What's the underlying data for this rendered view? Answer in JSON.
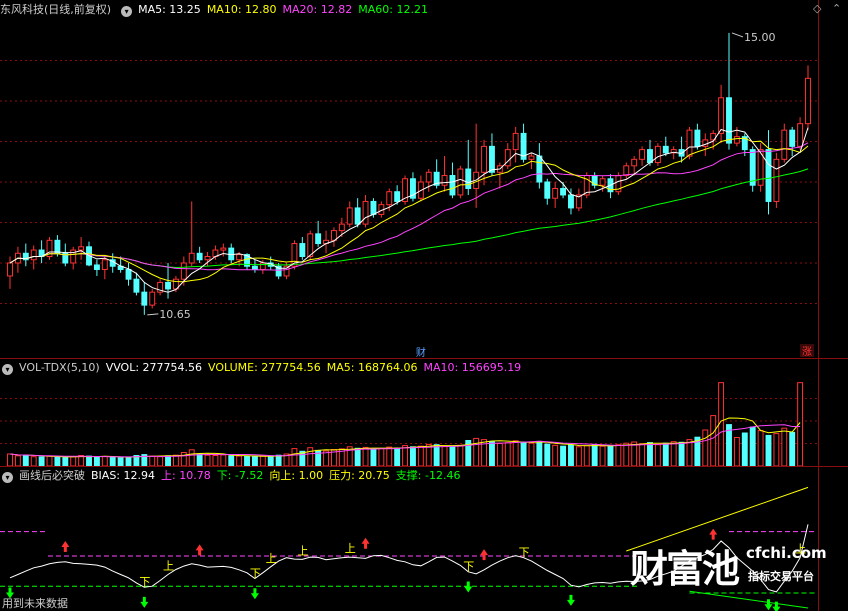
{
  "header1": {
    "title": "东风科技(日线,前复权)",
    "items": [
      {
        "text": "MA5: 13.25",
        "color": "#ffffff"
      },
      {
        "text": "MA10: 12.80",
        "color": "#ffff00"
      },
      {
        "text": "MA20: 12.82",
        "color": "#ff44ff"
      },
      {
        "text": "MA60: 12.21",
        "color": "#00ff00"
      }
    ]
  },
  "header2": {
    "title": "VOL-TDX(5,10)",
    "items": [
      {
        "text": "VVOL: 277754.56",
        "color": "#ffffff"
      },
      {
        "text": "VOLUME: 277754.56",
        "color": "#ffff00"
      },
      {
        "text": "MA5: 168764.06",
        "color": "#ffff00"
      },
      {
        "text": "MA10: 156695.19",
        "color": "#ff44ff"
      }
    ]
  },
  "header3": {
    "title": "画线后必突破",
    "items": [
      {
        "text": "BIAS: 12.94",
        "color": "#ffffff"
      },
      {
        "text": "上: 10.78",
        "color": "#ff44ff"
      },
      {
        "text": "下: -7.52",
        "color": "#00ff00"
      },
      {
        "text": "向上: 1.00",
        "color": "#ffff00"
      },
      {
        "text": "压力: 20.75",
        "color": "#ffff00"
      },
      {
        "text": "支撑: -12.46",
        "color": "#00ff00"
      }
    ]
  },
  "footer": "用到未来数据",
  "watermark": {
    "main": "财富池",
    "site": "cfchi.com",
    "sub": "指标交易平台"
  },
  "colors": {
    "up": "#ff3232",
    "down": "#54ffff",
    "ma5": "#ffffff",
    "ma10": "#ffff00",
    "ma20": "#ff44ff",
    "ma60": "#00ff00",
    "grid": "#8a0d0d"
  },
  "chart_data": [
    {
      "type": "candlestick",
      "ylim": [
        10.2,
        15.2
      ],
      "grid": true,
      "annotations": [
        {
          "label": "15.00",
          "at": "high"
        },
        {
          "label": "10.65",
          "at": "low"
        }
      ],
      "markers": [
        {
          "label": "财",
          "color": "#5aa0ff"
        },
        {
          "label": "涨",
          "color": "#ff3232"
        }
      ],
      "ohlc": [
        [
          11.25,
          11.55,
          11.05,
          11.45
        ],
        [
          11.45,
          11.7,
          11.3,
          11.6
        ],
        [
          11.6,
          11.75,
          11.4,
          11.5
        ],
        [
          11.5,
          11.72,
          11.35,
          11.65
        ],
        [
          11.65,
          11.8,
          11.45,
          11.55
        ],
        [
          11.55,
          11.85,
          11.5,
          11.8
        ],
        [
          11.8,
          11.88,
          11.55,
          11.6
        ],
        [
          11.6,
          11.75,
          11.4,
          11.45
        ],
        [
          11.45,
          11.7,
          11.35,
          11.65
        ],
        [
          11.65,
          11.85,
          11.5,
          11.7
        ],
        [
          11.7,
          11.78,
          11.4,
          11.42
        ],
        [
          11.42,
          11.5,
          11.25,
          11.35
        ],
        [
          11.35,
          11.55,
          11.2,
          11.5
        ],
        [
          11.5,
          11.6,
          11.3,
          11.4
        ],
        [
          11.4,
          11.55,
          11.3,
          11.35
        ],
        [
          11.35,
          11.45,
          11.1,
          11.2
        ],
        [
          11.2,
          11.3,
          10.95,
          11.0
        ],
        [
          11.0,
          11.15,
          10.65,
          10.8
        ],
        [
          10.8,
          11.05,
          10.75,
          11.0
        ],
        [
          11.0,
          11.2,
          10.95,
          11.15
        ],
        [
          11.15,
          11.45,
          10.9,
          11.05
        ],
        [
          11.05,
          11.25,
          11.0,
          11.2
        ],
        [
          11.2,
          11.55,
          11.1,
          11.45
        ],
        [
          11.45,
          12.4,
          11.4,
          11.6
        ],
        [
          11.6,
          11.7,
          11.45,
          11.5
        ],
        [
          11.5,
          11.62,
          11.4,
          11.55
        ],
        [
          11.55,
          11.72,
          11.5,
          11.65
        ],
        [
          11.65,
          11.75,
          11.55,
          11.68
        ],
        [
          11.68,
          11.75,
          11.45,
          11.5
        ],
        [
          11.5,
          11.62,
          11.4,
          11.58
        ],
        [
          11.58,
          11.6,
          11.35,
          11.4
        ],
        [
          11.4,
          11.5,
          11.3,
          11.35
        ],
        [
          11.35,
          11.5,
          11.28,
          11.45
        ],
        [
          11.45,
          11.55,
          11.35,
          11.4
        ],
        [
          11.4,
          11.45,
          11.2,
          11.25
        ],
        [
          11.25,
          11.45,
          11.2,
          11.4
        ],
        [
          11.4,
          11.8,
          11.35,
          11.75
        ],
        [
          11.75,
          11.85,
          11.5,
          11.55
        ],
        [
          11.55,
          11.95,
          11.5,
          11.9
        ],
        [
          11.9,
          12.1,
          11.7,
          11.75
        ],
        [
          11.75,
          11.95,
          11.6,
          11.8
        ],
        [
          11.8,
          12.0,
          11.7,
          11.95
        ],
        [
          11.95,
          12.15,
          11.85,
          12.05
        ],
        [
          12.05,
          12.4,
          12.0,
          12.3
        ],
        [
          12.3,
          12.45,
          12.0,
          12.05
        ],
        [
          12.05,
          12.5,
          12.0,
          12.4
        ],
        [
          12.4,
          12.45,
          12.15,
          12.2
        ],
        [
          12.2,
          12.4,
          12.15,
          12.35
        ],
        [
          12.35,
          12.6,
          12.25,
          12.55
        ],
        [
          12.55,
          12.65,
          12.35,
          12.4
        ],
        [
          12.4,
          12.8,
          12.35,
          12.75
        ],
        [
          12.75,
          12.85,
          12.4,
          12.45
        ],
        [
          12.45,
          12.8,
          12.4,
          12.7
        ],
        [
          12.7,
          12.9,
          12.55,
          12.85
        ],
        [
          12.85,
          13.05,
          12.6,
          12.65
        ],
        [
          12.65,
          13.1,
          12.55,
          12.8
        ],
        [
          12.8,
          13.0,
          12.45,
          12.5
        ],
        [
          12.5,
          12.95,
          12.45,
          12.9
        ],
        [
          12.9,
          13.35,
          12.5,
          12.6
        ],
        [
          12.6,
          13.6,
          12.3,
          12.85
        ],
        [
          12.85,
          13.35,
          12.65,
          13.25
        ],
        [
          13.25,
          13.45,
          12.8,
          12.85
        ],
        [
          12.85,
          13.0,
          12.6,
          12.95
        ],
        [
          12.95,
          13.3,
          12.9,
          13.2
        ],
        [
          13.2,
          13.55,
          13.0,
          13.45
        ],
        [
          13.45,
          13.6,
          13.0,
          13.05
        ],
        [
          13.05,
          13.15,
          12.9,
          13.1
        ],
        [
          13.1,
          13.3,
          12.6,
          12.7
        ],
        [
          12.7,
          12.75,
          12.35,
          12.45
        ],
        [
          12.45,
          12.7,
          12.3,
          12.6
        ],
        [
          12.6,
          12.7,
          12.45,
          12.5
        ],
        [
          12.5,
          12.6,
          12.2,
          12.3
        ],
        [
          12.3,
          12.6,
          12.25,
          12.5
        ],
        [
          12.5,
          12.85,
          12.45,
          12.8
        ],
        [
          12.8,
          12.85,
          12.6,
          12.65
        ],
        [
          12.65,
          12.8,
          12.55,
          12.75
        ],
        [
          12.75,
          12.82,
          12.45,
          12.55
        ],
        [
          12.55,
          12.85,
          12.5,
          12.8
        ],
        [
          12.8,
          13.0,
          12.75,
          12.95
        ],
        [
          12.95,
          13.1,
          12.8,
          13.05
        ],
        [
          13.05,
          13.25,
          12.95,
          13.2
        ],
        [
          13.2,
          13.35,
          12.95,
          13.0
        ],
        [
          13.0,
          13.3,
          12.95,
          13.25
        ],
        [
          13.25,
          13.4,
          13.1,
          13.15
        ],
        [
          13.15,
          13.25,
          13.05,
          13.2
        ],
        [
          13.2,
          13.4,
          13.0,
          13.1
        ],
        [
          13.1,
          13.55,
          13.05,
          13.5
        ],
        [
          13.5,
          13.6,
          13.2,
          13.25
        ],
        [
          13.25,
          13.45,
          13.1,
          13.35
        ],
        [
          13.35,
          13.5,
          13.2,
          13.45
        ],
        [
          13.45,
          14.2,
          13.3,
          14.0
        ],
        [
          14.0,
          15.0,
          13.2,
          13.3
        ],
        [
          13.3,
          13.55,
          13.25,
          13.4
        ],
        [
          13.4,
          13.45,
          13.1,
          13.2
        ],
        [
          13.2,
          13.25,
          12.55,
          12.65
        ],
        [
          12.65,
          13.3,
          12.55,
          13.2
        ],
        [
          13.2,
          13.5,
          12.2,
          12.4
        ],
        [
          12.4,
          13.15,
          12.3,
          13.05
        ],
        [
          13.05,
          13.6,
          13.0,
          13.5
        ],
        [
          13.5,
          13.55,
          13.1,
          13.25
        ],
        [
          13.25,
          13.7,
          13.2,
          13.6
        ],
        [
          13.6,
          14.5,
          13.5,
          14.3
        ]
      ]
    },
    {
      "type": "bar",
      "ylim": [
        0,
        300000
      ],
      "volume": [
        40000,
        34000,
        36000,
        31000,
        30000,
        33000,
        29000,
        28000,
        31000,
        35000,
        33000,
        30000,
        32000,
        29000,
        27000,
        30000,
        35000,
        38000,
        33000,
        31000,
        34000,
        36000,
        45000,
        54000,
        40000,
        36000,
        35000,
        37000,
        34000,
        33000,
        32000,
        31000,
        33000,
        34000,
        36000,
        40000,
        58000,
        49000,
        61000,
        52000,
        50000,
        55000,
        57000,
        64000,
        59000,
        62000,
        56000,
        58000,
        63000,
        60000,
        68000,
        64000,
        66000,
        72000,
        71000,
        67000,
        64000,
        69000,
        85000,
        92000,
        88000,
        82000,
        75000,
        78000,
        84000,
        80000,
        76000,
        82000,
        73000,
        69000,
        66000,
        70000,
        64000,
        68000,
        72000,
        66000,
        65000,
        71000,
        76000,
        80000,
        74000,
        78000,
        71000,
        76000,
        81000,
        79000,
        88000,
        96000,
        120000,
        168000,
        277754,
        138000,
        95000,
        110000,
        130000,
        118000,
        102000,
        108000,
        126000,
        112000,
        277754
      ],
      "vol_up_down": "up-red, down-cyan"
    },
    {
      "type": "line",
      "series": [
        {
          "name": "BIAS",
          "values": [
            -3,
            -2,
            -1,
            0,
            0.5,
            1.2,
            1.6,
            1.8,
            1.3,
            1.2,
            1.0,
            0.8,
            0.2,
            -1.0,
            -2.0,
            -3.0,
            -4.5,
            -5.8,
            -5.5,
            -3.8,
            -2.0,
            -0.5,
            0.5,
            1.2,
            0.8,
            0.2,
            0.3,
            0.4,
            0.1,
            -0.6,
            -1.5,
            -3.2,
            -1.5,
            0.3,
            2.0,
            3.0,
            2.6,
            2.5,
            3.2,
            3.1,
            2.4,
            2.7,
            3.0,
            3.2,
            3.0,
            2.8,
            3.6,
            3.7,
            3.0,
            2.2,
            1.8,
            0.9,
            0.6,
            1.8,
            3.1,
            3.2,
            2.0,
            0.7,
            -1.2,
            -1.8,
            -0.6,
            0.8,
            2.0,
            3.0,
            3.6,
            3.0,
            2.0,
            0.6,
            -0.8,
            -2.0,
            -3.2,
            -5.2,
            -5.7,
            -5.0,
            -4.5,
            -4.4,
            -4.6,
            -4.2,
            -4.0,
            -4.1,
            -3.9,
            -3.5,
            -2.5,
            -1.8,
            -1.0,
            0.5,
            2.0,
            3.0,
            4.0,
            5.5,
            8.0,
            6.0,
            3.0,
            1.0,
            -1.0,
            -3.5,
            -6.5,
            -7.2,
            -4.0,
            -1.0,
            3.0,
            12.94
          ]
        },
        {
          "name": "上",
          "values": []
        },
        {
          "name": "下",
          "values": []
        },
        {
          "name": "压力"
        },
        {
          "name": "支撑"
        }
      ],
      "up_level": 10.78,
      "down_level": -7.52,
      "label_up": "上",
      "label_down": "下",
      "ylim": [
        -12,
        25
      ]
    }
  ]
}
